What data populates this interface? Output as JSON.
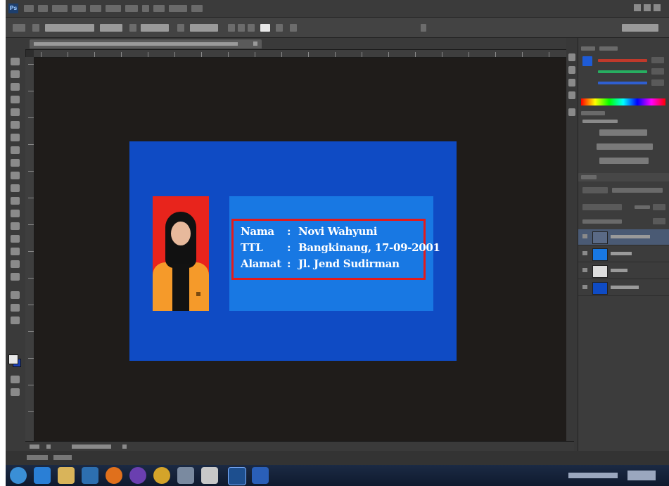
{
  "app": {
    "name": "Photoshop",
    "logo_text": "Ps"
  },
  "card": {
    "background_color": "#0f4bc4",
    "info_box_color": "#1878e3",
    "selection_color": "#e21b1b",
    "rows": [
      {
        "label": "Nama",
        "colon": ":",
        "value": "Novi Wahyuni"
      },
      {
        "label": "TTL",
        "colon": ":",
        "value": "Bangkinang, 17-09-2001"
      },
      {
        "label": "Alamat",
        "colon": ":",
        "value": "Jl. Jend Sudirman"
      }
    ]
  },
  "icons": {
    "start": "windows-start-icon",
    "browser": "internet-explorer-icon",
    "explorer": "file-explorer-icon",
    "photoshop": "photoshop-icon"
  }
}
